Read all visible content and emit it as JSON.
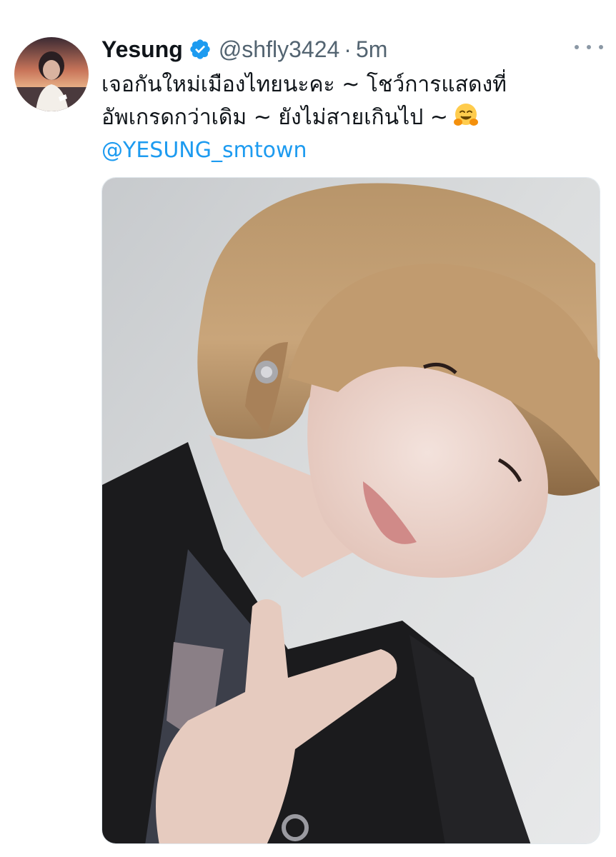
{
  "tweet": {
    "author": {
      "display_name": "Yesung",
      "handle": "@shfly3424",
      "verified": true
    },
    "separator": "·",
    "timestamp": "5m",
    "text_lines": [
      "เจอกันใหม่เมืองไทยนะคะ ~ โชว์การแสดงที่",
      "อัพเกรดกว่าเดิม ~ ยังไม่สายเกินไป ~"
    ],
    "emoji": "hugging-face",
    "mention": "@YESUNG_smtown",
    "media": {
      "type": "photo",
      "icon": "selfie-photo"
    }
  },
  "colors": {
    "text": "#0f1419",
    "secondary": "#536471",
    "accent": "#1d9bf0",
    "verified": "#1d9bf0"
  }
}
